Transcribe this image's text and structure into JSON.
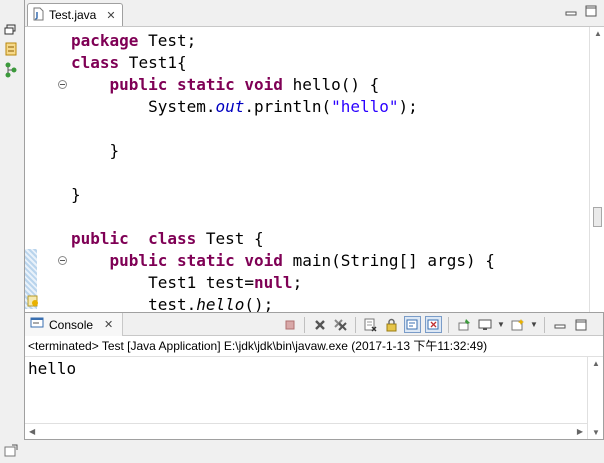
{
  "editor": {
    "tab_label": "Test.java",
    "close_glyph": "✕",
    "code_lines": [
      [
        {
          "t": "package",
          "c": "kw"
        },
        {
          "t": " Test;"
        }
      ],
      [
        {
          "t": "class",
          "c": "kw"
        },
        {
          "t": " Test1{"
        }
      ],
      [
        {
          "t": "    "
        },
        {
          "t": "public",
          "c": "kw"
        },
        {
          "t": " "
        },
        {
          "t": "static",
          "c": "kw"
        },
        {
          "t": " "
        },
        {
          "t": "void",
          "c": "kw"
        },
        {
          "t": " hello() {"
        }
      ],
      [
        {
          "t": "        System."
        },
        {
          "t": "out",
          "c": "stat"
        },
        {
          "t": ".println("
        },
        {
          "t": "\"hello\"",
          "c": "str"
        },
        {
          "t": ");"
        }
      ],
      [
        {
          "t": ""
        }
      ],
      [
        {
          "t": "    }"
        }
      ],
      [
        {
          "t": ""
        }
      ],
      [
        {
          "t": "}"
        }
      ],
      [
        {
          "t": ""
        }
      ],
      [
        {
          "t": "public",
          "c": "kw"
        },
        {
          "t": "  "
        },
        {
          "t": "class",
          "c": "kw"
        },
        {
          "t": " Test {"
        }
      ],
      [
        {
          "t": "    "
        },
        {
          "t": "public",
          "c": "kw"
        },
        {
          "t": " "
        },
        {
          "t": "static",
          "c": "kw"
        },
        {
          "t": " "
        },
        {
          "t": "void",
          "c": "kw"
        },
        {
          "t": " main(String[] args) {"
        }
      ],
      [
        {
          "t": "        Test1 test="
        },
        {
          "t": "null",
          "c": "kw"
        },
        {
          "t": ";"
        }
      ],
      [
        {
          "t": "        test."
        },
        {
          "t": "hello",
          "c": "ital"
        },
        {
          "t": "();"
        }
      ]
    ]
  },
  "console": {
    "tab_label": "Console",
    "close_glyph": "✕",
    "status": "<terminated> Test [Java Application] E:\\jdk\\jdk\\bin\\javaw.exe (2017-1-13 下午11:32:49)",
    "output": "hello",
    "toolbar": [
      {
        "name": "terminate-button",
        "icon": "terminate-icon"
      },
      {
        "name": "remove-launch-button",
        "icon": "remove-launch-icon"
      },
      {
        "name": "remove-all-terminated-button",
        "icon": "remove-all-icon"
      },
      {
        "name": "clear-console-button",
        "icon": "clear-icon"
      },
      {
        "name": "scroll-lock-button",
        "icon": "scroll-lock-icon"
      },
      {
        "name": "show-on-stdout-button",
        "icon": "stdout-icon",
        "pressed": true
      },
      {
        "name": "show-on-stderr-button",
        "icon": "stderr-icon",
        "pressed": true
      },
      {
        "name": "pin-console-button",
        "icon": "pin-icon"
      },
      {
        "name": "display-selected-console-button",
        "icon": "display-console-icon"
      },
      {
        "name": "open-console-button",
        "icon": "open-console-icon"
      }
    ]
  },
  "colors": {
    "keyword": "#7f0055",
    "string": "#2a00ff",
    "static_field": "#0000c0"
  }
}
